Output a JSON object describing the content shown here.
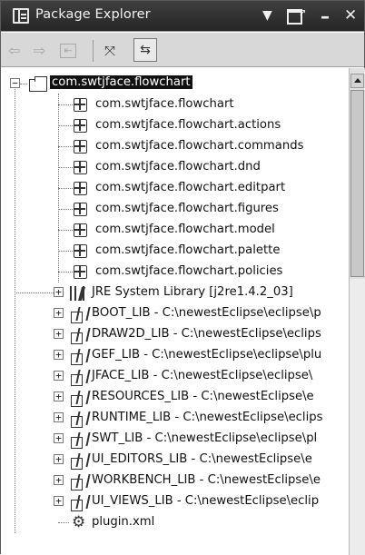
{
  "view": {
    "title": "Package Explorer",
    "buttons": {
      "view_menu": "view-menu-dropdown-icon",
      "maximize": "maximize-icon",
      "minimize": "minimize-icon",
      "close": "close-icon"
    }
  },
  "toolbar": {
    "items": [
      "back-arrow-icon",
      "forward-arrow-icon",
      "up-folder-icon",
      "collapse-all-icon",
      "link-with-editor-icon"
    ]
  },
  "tree": {
    "project": "com.swtjface.flowchart",
    "packages": [
      "com.swtjface.flowchart",
      "com.swtjface.flowchart.actions",
      "com.swtjface.flowchart.commands",
      "com.swtjface.flowchart.dnd",
      "com.swtjface.flowchart.editpart",
      "com.swtjface.flowchart.figures",
      "com.swtjface.flowchart.model",
      "com.swtjface.flowchart.palette",
      "com.swtjface.flowchart.policies"
    ],
    "jre": "JRE System Library [j2re1.4.2_03]",
    "libraries": [
      "BOOT_LIB - C:\\newestEclipse\\eclipse\\p",
      "DRAW2D_LIB - C:\\newestEclipse\\eclips",
      "GEF_LIB - C:\\newestEclipse\\eclipse\\plu",
      "JFACE_LIB - C:\\newestEclipse\\eclipse\\",
      "RESOURCES_LIB - C:\\newestEclipse\\e",
      "RUNTIME_LIB - C:\\newestEclipse\\eclips",
      "SWT_LIB - C:\\newestEclipse\\eclipse\\pl",
      "UI_EDITORS_LIB - C:\\newestEclipse\\e",
      "WORKBENCH_LIB - C:\\newestEclipse\\e",
      "UI_VIEWS_LIB - C:\\newestEclipse\\eclip"
    ],
    "file": "plugin.xml",
    "expander_collapsed": "+",
    "expander_expanded": "−"
  },
  "colors": {
    "titlebar": "#2e2e2e",
    "toolbar": "#d8d8d8",
    "selection": "#111111"
  }
}
